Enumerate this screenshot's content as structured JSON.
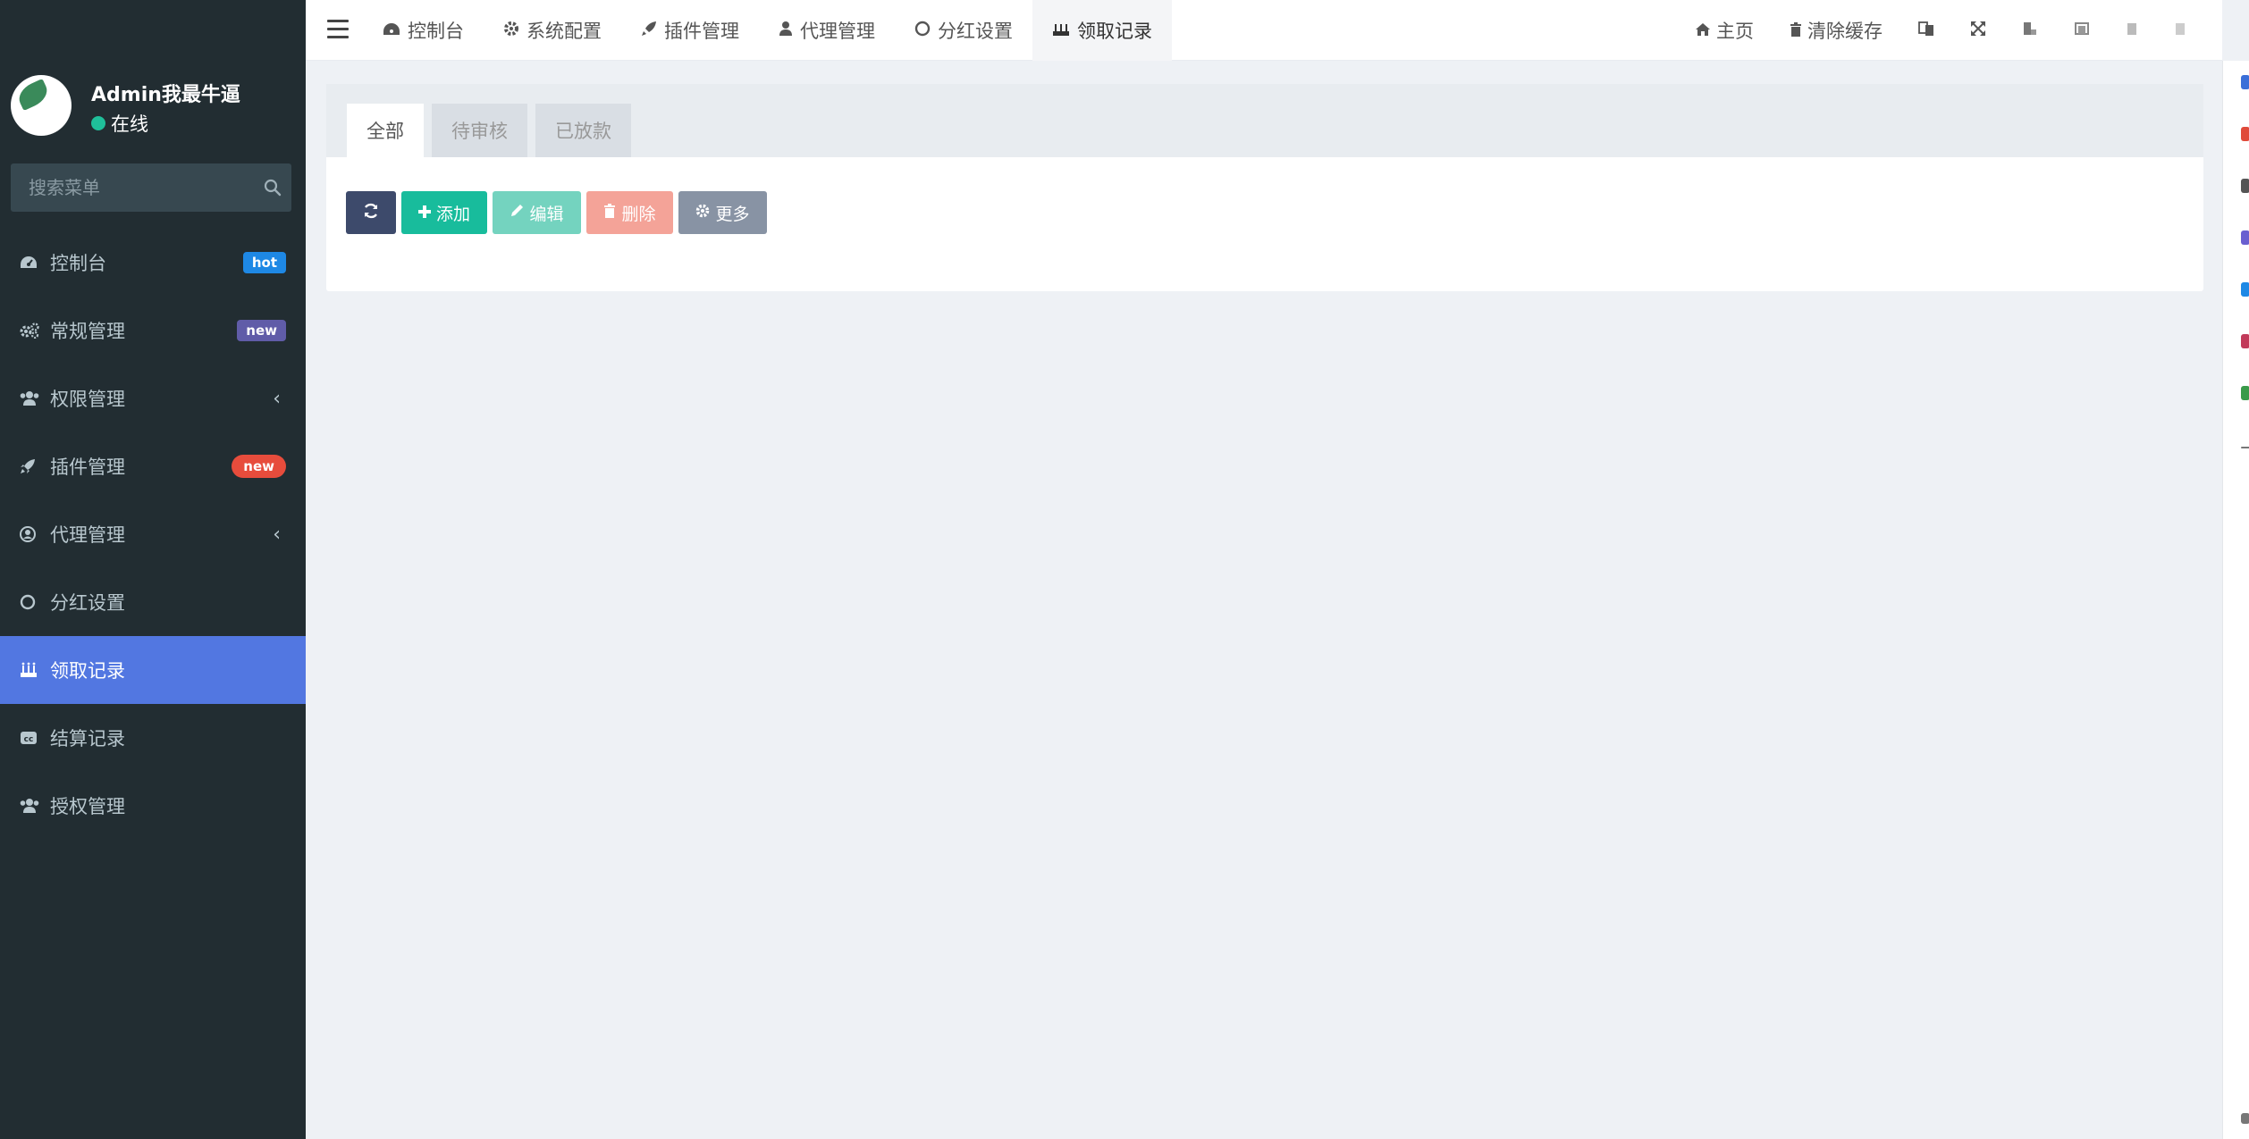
{
  "user": {
    "name": "Admin我最牛逼",
    "status": "在线"
  },
  "search": {
    "placeholder": "搜索菜单"
  },
  "sidebar": {
    "items": [
      {
        "label": "控制台",
        "badge": "hot"
      },
      {
        "label": "常规管理",
        "badge": "new"
      },
      {
        "label": "权限管理"
      },
      {
        "label": "插件管理",
        "badge": "new"
      },
      {
        "label": "代理管理"
      },
      {
        "label": "分红设置"
      },
      {
        "label": "领取记录"
      },
      {
        "label": "结算记录"
      },
      {
        "label": "授权管理"
      }
    ]
  },
  "header": {
    "tabs": [
      {
        "label": "控制台"
      },
      {
        "label": "系统配置"
      },
      {
        "label": "插件管理"
      },
      {
        "label": "代理管理"
      },
      {
        "label": "分红设置"
      },
      {
        "label": "领取记录"
      }
    ],
    "home": "主页",
    "clear_cache": "清除缓存"
  },
  "content": {
    "tabs": [
      "全部",
      "待审核",
      "已放款"
    ],
    "toolbar": {
      "add": "添加",
      "edit": "编辑",
      "delete": "删除",
      "more": "更多"
    }
  },
  "colors": {
    "sidebar_bg": "#222d32",
    "active_item": "#5277e1",
    "add": "#18bc9c",
    "edit": "#74d3bf",
    "delete": "#f4a398",
    "more": "#8893a4",
    "refresh": "#3d4a6b"
  }
}
